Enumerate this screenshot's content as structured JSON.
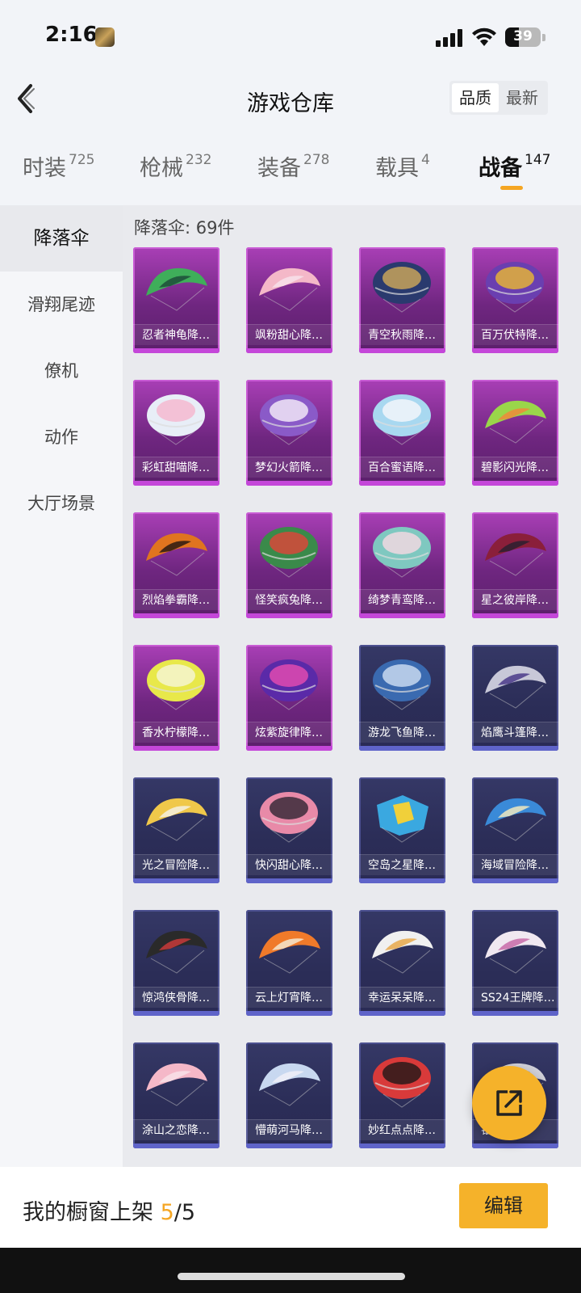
{
  "status_bar": {
    "time": "2:16",
    "battery": "39",
    "battery_level": 0.39
  },
  "header": {
    "title": "游戏仓库",
    "sort_options": [
      {
        "label": "品质",
        "active": true
      },
      {
        "label": "最新",
        "active": false
      }
    ]
  },
  "tabs": [
    {
      "label": "时装",
      "count": "725",
      "active": false
    },
    {
      "label": "枪械",
      "count": "232",
      "active": false
    },
    {
      "label": "装备",
      "count": "278",
      "active": false
    },
    {
      "label": "载具",
      "count": "4",
      "active": false
    },
    {
      "label": "战备",
      "count": "147",
      "active": true
    }
  ],
  "sidebar": {
    "items": [
      {
        "label": "降落伞",
        "active": true
      },
      {
        "label": "滑翔尾迹",
        "active": false
      },
      {
        "label": "僚机",
        "active": false
      },
      {
        "label": "动作",
        "active": false
      },
      {
        "label": "大厅场景",
        "active": false
      }
    ]
  },
  "content": {
    "header": "降落伞: 69件",
    "items": [
      {
        "name": "忍者神龟降…",
        "rarity": "purple",
        "shape": "wing",
        "colors": [
          "#3fae5a",
          "#1d4d3a"
        ]
      },
      {
        "name": "飒粉甜心降…",
        "rarity": "purple",
        "shape": "wing",
        "colors": [
          "#f4b8c8",
          "#f7e1ea"
        ]
      },
      {
        "name": "青空秋雨降…",
        "rarity": "purple",
        "shape": "round",
        "colors": [
          "#2a3a6e",
          "#c7a35a"
        ]
      },
      {
        "name": "百万伏特降…",
        "rarity": "purple",
        "shape": "round",
        "colors": [
          "#6a3fb0",
          "#e3b23a"
        ]
      },
      {
        "name": "彩虹甜喵降…",
        "rarity": "purple",
        "shape": "round",
        "colors": [
          "#e8eef7",
          "#f5b8d0"
        ]
      },
      {
        "name": "梦幻火箭降…",
        "rarity": "purple",
        "shape": "round",
        "colors": [
          "#8a5ac8",
          "#f0e6f7"
        ]
      },
      {
        "name": "百合蜜语降…",
        "rarity": "purple",
        "shape": "round",
        "colors": [
          "#a8d8f0",
          "#f2f6fa"
        ]
      },
      {
        "name": "碧影闪光降…",
        "rarity": "purple",
        "shape": "wing",
        "colors": [
          "#9ad64a",
          "#f08a3a"
        ]
      },
      {
        "name": "烈焰拳霸降…",
        "rarity": "purple",
        "shape": "wing",
        "colors": [
          "#e0741f",
          "#2a1a12"
        ]
      },
      {
        "name": "怪笑疯兔降…",
        "rarity": "purple",
        "shape": "round",
        "colors": [
          "#3a8a4a",
          "#d8483a"
        ]
      },
      {
        "name": "绮梦青鸾降…",
        "rarity": "purple",
        "shape": "round",
        "colors": [
          "#7fc8c0",
          "#f0d8e0"
        ]
      },
      {
        "name": "星之彼岸降…",
        "rarity": "purple",
        "shape": "wing",
        "colors": [
          "#8a1f3a",
          "#2a2030"
        ]
      },
      {
        "name": "香水柠檬降…",
        "rarity": "purple",
        "shape": "round",
        "colors": [
          "#e8e84a",
          "#f5f5d0"
        ]
      },
      {
        "name": "炫紫旋律降…",
        "rarity": "purple",
        "shape": "round",
        "colors": [
          "#5a2aa8",
          "#e04ab0"
        ]
      },
      {
        "name": "游龙飞鱼降…",
        "rarity": "blue",
        "shape": "round",
        "colors": [
          "#3a6ab0",
          "#c8d8f0"
        ]
      },
      {
        "name": "焰鹰斗篷降…",
        "rarity": "blue",
        "shape": "wing",
        "colors": [
          "#c8c8d8",
          "#4a3a8a"
        ]
      },
      {
        "name": "光之冒险降…",
        "rarity": "blue",
        "shape": "wing",
        "colors": [
          "#f0c84a",
          "#f5f0e0"
        ]
      },
      {
        "name": "快闪甜心降…",
        "rarity": "blue",
        "shape": "round",
        "colors": [
          "#e88aa8",
          "#3a2a3a"
        ]
      },
      {
        "name": "空岛之星降…",
        "rarity": "blue",
        "shape": "square",
        "colors": [
          "#3aa8e0",
          "#f0d03a"
        ]
      },
      {
        "name": "海域冒险降…",
        "rarity": "blue",
        "shape": "wing",
        "colors": [
          "#3a8ad8",
          "#f0e8c0"
        ]
      },
      {
        "name": "惊鸿侠骨降…",
        "rarity": "blue",
        "shape": "wing",
        "colors": [
          "#2a2a2a",
          "#c83a3a"
        ]
      },
      {
        "name": "云上灯宵降…",
        "rarity": "blue",
        "shape": "wing",
        "colors": [
          "#f07a2a",
          "#f5e8d0"
        ]
      },
      {
        "name": "幸运呆呆降…",
        "rarity": "blue",
        "shape": "wing",
        "colors": [
          "#f0f0f0",
          "#e8a84a"
        ]
      },
      {
        "name": "SS24王牌降…",
        "rarity": "blue",
        "shape": "wing",
        "colors": [
          "#f0e8f0",
          "#c86aa8"
        ]
      },
      {
        "name": "涂山之恋降…",
        "rarity": "blue",
        "shape": "wing",
        "colors": [
          "#f5b8c8",
          "#f8e0e8"
        ]
      },
      {
        "name": "懵萌河马降…",
        "rarity": "blue",
        "shape": "wing",
        "colors": [
          "#c8d8f0",
          "#f0f0f8"
        ]
      },
      {
        "name": "妙红点点降…",
        "rarity": "blue",
        "shape": "round",
        "colors": [
          "#d83a3a",
          "#2a1a1a"
        ]
      },
      {
        "name": "银…",
        "rarity": "blue",
        "shape": "wing",
        "colors": [
          "#d0d0d8",
          "#8a8aa0"
        ]
      }
    ]
  },
  "bottom_bar": {
    "shelf_label": "我的橱窗上架",
    "shelf_current": "5",
    "shelf_separator": "/",
    "shelf_total": "5",
    "edit_label": "编辑"
  },
  "colors": {
    "accent": "#f5a623",
    "button": "#f5b22a",
    "purple_card": "#6f2680",
    "blue_card": "#2b2d57"
  }
}
